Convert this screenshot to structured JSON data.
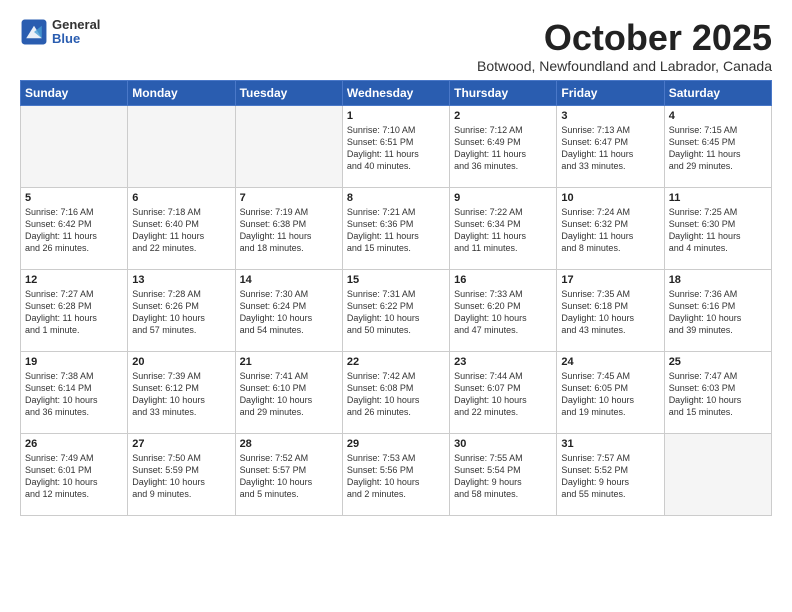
{
  "logo": {
    "general": "General",
    "blue": "Blue"
  },
  "title": "October 2025",
  "location": "Botwood, Newfoundland and Labrador, Canada",
  "weekdays": [
    "Sunday",
    "Monday",
    "Tuesday",
    "Wednesday",
    "Thursday",
    "Friday",
    "Saturday"
  ],
  "weeks": [
    [
      {
        "day": "",
        "info": ""
      },
      {
        "day": "",
        "info": ""
      },
      {
        "day": "",
        "info": ""
      },
      {
        "day": "1",
        "info": "Sunrise: 7:10 AM\nSunset: 6:51 PM\nDaylight: 11 hours\nand 40 minutes."
      },
      {
        "day": "2",
        "info": "Sunrise: 7:12 AM\nSunset: 6:49 PM\nDaylight: 11 hours\nand 36 minutes."
      },
      {
        "day": "3",
        "info": "Sunrise: 7:13 AM\nSunset: 6:47 PM\nDaylight: 11 hours\nand 33 minutes."
      },
      {
        "day": "4",
        "info": "Sunrise: 7:15 AM\nSunset: 6:45 PM\nDaylight: 11 hours\nand 29 minutes."
      }
    ],
    [
      {
        "day": "5",
        "info": "Sunrise: 7:16 AM\nSunset: 6:42 PM\nDaylight: 11 hours\nand 26 minutes."
      },
      {
        "day": "6",
        "info": "Sunrise: 7:18 AM\nSunset: 6:40 PM\nDaylight: 11 hours\nand 22 minutes."
      },
      {
        "day": "7",
        "info": "Sunrise: 7:19 AM\nSunset: 6:38 PM\nDaylight: 11 hours\nand 18 minutes."
      },
      {
        "day": "8",
        "info": "Sunrise: 7:21 AM\nSunset: 6:36 PM\nDaylight: 11 hours\nand 15 minutes."
      },
      {
        "day": "9",
        "info": "Sunrise: 7:22 AM\nSunset: 6:34 PM\nDaylight: 11 hours\nand 11 minutes."
      },
      {
        "day": "10",
        "info": "Sunrise: 7:24 AM\nSunset: 6:32 PM\nDaylight: 11 hours\nand 8 minutes."
      },
      {
        "day": "11",
        "info": "Sunrise: 7:25 AM\nSunset: 6:30 PM\nDaylight: 11 hours\nand 4 minutes."
      }
    ],
    [
      {
        "day": "12",
        "info": "Sunrise: 7:27 AM\nSunset: 6:28 PM\nDaylight: 11 hours\nand 1 minute."
      },
      {
        "day": "13",
        "info": "Sunrise: 7:28 AM\nSunset: 6:26 PM\nDaylight: 10 hours\nand 57 minutes."
      },
      {
        "day": "14",
        "info": "Sunrise: 7:30 AM\nSunset: 6:24 PM\nDaylight: 10 hours\nand 54 minutes."
      },
      {
        "day": "15",
        "info": "Sunrise: 7:31 AM\nSunset: 6:22 PM\nDaylight: 10 hours\nand 50 minutes."
      },
      {
        "day": "16",
        "info": "Sunrise: 7:33 AM\nSunset: 6:20 PM\nDaylight: 10 hours\nand 47 minutes."
      },
      {
        "day": "17",
        "info": "Sunrise: 7:35 AM\nSunset: 6:18 PM\nDaylight: 10 hours\nand 43 minutes."
      },
      {
        "day": "18",
        "info": "Sunrise: 7:36 AM\nSunset: 6:16 PM\nDaylight: 10 hours\nand 39 minutes."
      }
    ],
    [
      {
        "day": "19",
        "info": "Sunrise: 7:38 AM\nSunset: 6:14 PM\nDaylight: 10 hours\nand 36 minutes."
      },
      {
        "day": "20",
        "info": "Sunrise: 7:39 AM\nSunset: 6:12 PM\nDaylight: 10 hours\nand 33 minutes."
      },
      {
        "day": "21",
        "info": "Sunrise: 7:41 AM\nSunset: 6:10 PM\nDaylight: 10 hours\nand 29 minutes."
      },
      {
        "day": "22",
        "info": "Sunrise: 7:42 AM\nSunset: 6:08 PM\nDaylight: 10 hours\nand 26 minutes."
      },
      {
        "day": "23",
        "info": "Sunrise: 7:44 AM\nSunset: 6:07 PM\nDaylight: 10 hours\nand 22 minutes."
      },
      {
        "day": "24",
        "info": "Sunrise: 7:45 AM\nSunset: 6:05 PM\nDaylight: 10 hours\nand 19 minutes."
      },
      {
        "day": "25",
        "info": "Sunrise: 7:47 AM\nSunset: 6:03 PM\nDaylight: 10 hours\nand 15 minutes."
      }
    ],
    [
      {
        "day": "26",
        "info": "Sunrise: 7:49 AM\nSunset: 6:01 PM\nDaylight: 10 hours\nand 12 minutes."
      },
      {
        "day": "27",
        "info": "Sunrise: 7:50 AM\nSunset: 5:59 PM\nDaylight: 10 hours\nand 9 minutes."
      },
      {
        "day": "28",
        "info": "Sunrise: 7:52 AM\nSunset: 5:57 PM\nDaylight: 10 hours\nand 5 minutes."
      },
      {
        "day": "29",
        "info": "Sunrise: 7:53 AM\nSunset: 5:56 PM\nDaylight: 10 hours\nand 2 minutes."
      },
      {
        "day": "30",
        "info": "Sunrise: 7:55 AM\nSunset: 5:54 PM\nDaylight: 9 hours\nand 58 minutes."
      },
      {
        "day": "31",
        "info": "Sunrise: 7:57 AM\nSunset: 5:52 PM\nDaylight: 9 hours\nand 55 minutes."
      },
      {
        "day": "",
        "info": ""
      }
    ]
  ]
}
